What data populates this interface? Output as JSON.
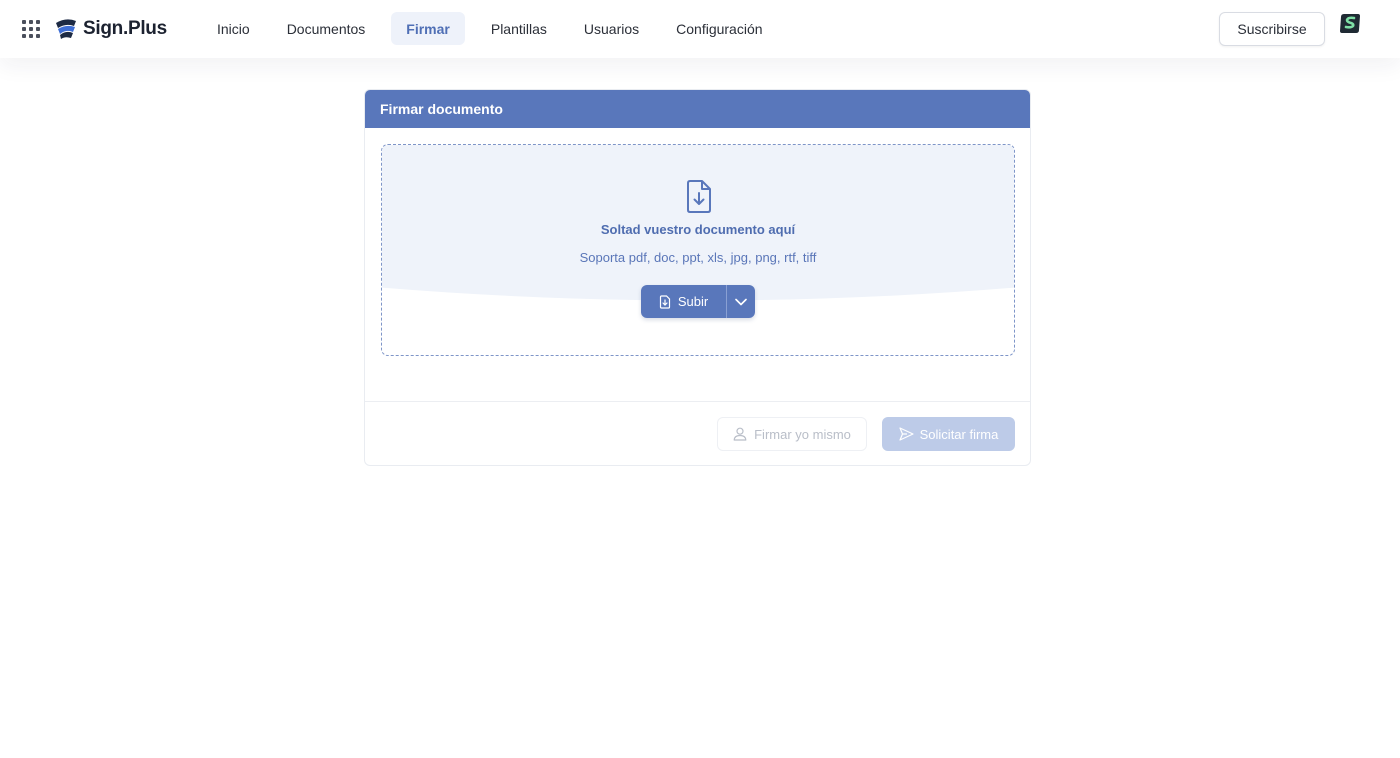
{
  "app": {
    "brand": "Sign.Plus"
  },
  "header": {
    "apps_icon": "grid-icon",
    "nav": [
      {
        "label": "Inicio",
        "active": false
      },
      {
        "label": "Documentos",
        "active": false
      },
      {
        "label": "Firmar",
        "active": true
      },
      {
        "label": "Plantillas",
        "active": false
      },
      {
        "label": "Usuarios",
        "active": false
      },
      {
        "label": "Configuración",
        "active": false
      }
    ],
    "subscribe_label": "Suscribirse"
  },
  "card": {
    "title": "Firmar documento",
    "dropzone": {
      "title": "Soltad vuestro documento aquí",
      "subtitle": "Soporta pdf, doc, ppt, xls, jpg, png, rtf, tiff",
      "upload_label": "Subir"
    },
    "footer": {
      "sign_self_label": "Firmar yo mismo",
      "request_label": "Solicitar firma"
    }
  },
  "colors": {
    "accent": "#5977bb",
    "active_tab_bg": "#eef2fa",
    "dropzone_tint": "#eff3fa",
    "disabled_button": "#bdcbe8"
  }
}
